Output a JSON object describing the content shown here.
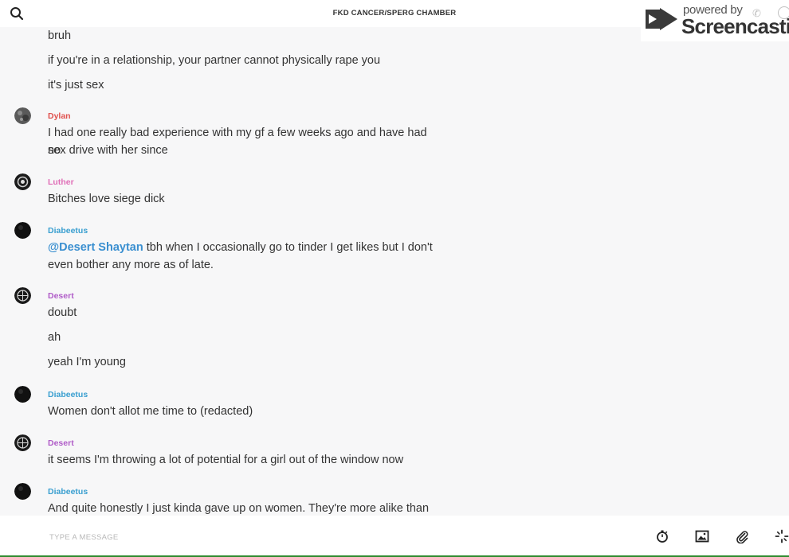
{
  "header": {
    "title": "FKD CANCER/SPERG CHAMBER",
    "search_icon": "search-icon"
  },
  "watermark": {
    "powered_by": "powered by",
    "brand": "Screencastify"
  },
  "messages": {
    "group0": {
      "lines": [
        "bruh",
        "if you're in a relationship, your partner cannot physically rape you",
        "it's just sex"
      ]
    },
    "group1": {
      "author": "Dylan",
      "author_color": "#e0524f",
      "lines": [
        "I had one really bad experience with my gf a few weeks ago and have had no",
        "sex drive with her since"
      ]
    },
    "group2": {
      "author": "Luther",
      "author_color": "#e070b8",
      "lines": [
        "Bitches love siege dick"
      ]
    },
    "group3": {
      "author": "Diabeetus",
      "author_color": "#3a9fd0",
      "mention": "@Desert Shaytan",
      "line1_rest": " tbh when I occasionally go to tinder I get likes but I don't",
      "line2": "even bother any more as of late."
    },
    "group4": {
      "author": "Desert",
      "author_color": "#b05cc8",
      "lines": [
        "doubt",
        "ah",
        "yeah I'm young"
      ]
    },
    "group5": {
      "author": "Diabeetus",
      "author_color": "#3a9fd0",
      "lines": [
        "Women don't allot me time to (redacted)"
      ]
    },
    "group6": {
      "author": "Desert",
      "author_color": "#b05cc8",
      "lines": [
        "it seems I'm throwing a lot of potential for a girl out of the window now"
      ]
    },
    "group7": {
      "author": "Diabeetus",
      "author_color": "#3a9fd0",
      "lines": [
        "And quite honestly I just kinda gave up on women. They're more alike than"
      ]
    }
  },
  "composer": {
    "placeholder": "TYPE A MESSAGE",
    "tools": [
      "timer-icon",
      "image-icon",
      "paperclip-icon",
      "sparkle-icon"
    ]
  }
}
